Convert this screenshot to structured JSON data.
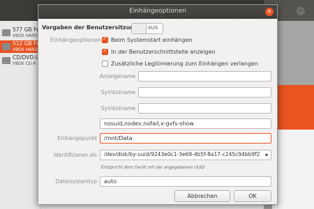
{
  "background": {
    "drives": [
      {
        "line1": "577 GB Fe",
        "line2": "VBOX HARD",
        "selected": false
      },
      {
        "line1": "512 GB Fe",
        "line2": "VBOX HARD",
        "selected": true
      },
      {
        "line1": "CD/DVD-L",
        "line2": "VBOX CD-R",
        "selected": false
      }
    ]
  },
  "dialog": {
    "title": "Einhängeoptionen",
    "user_defaults_label": "Vorgaben der Benutzersitzung",
    "user_defaults_toggle": "AUS",
    "mount_options_label": "Einhängeoptionen",
    "checkboxes": [
      {
        "label": "Beim Systemstart einhängen",
        "checked": true
      },
      {
        "label": "In der Benutzerschnittstelle anzeigen",
        "checked": true
      },
      {
        "label": "Zusätzliche Legitimierung zum Einhängen verlangen",
        "checked": false
      }
    ],
    "display_name_placeholder": "Anzeigename",
    "icon_name_placeholder": "Symbolname",
    "symbolic_icon_name_placeholder": "Symbolname",
    "options_value": "nosuid,nodev,nofail,x-gvfs-show",
    "mount_point_label": "Einhängepunkt",
    "mount_point_value": "/mnt/Data",
    "identify_as_label": "Identifizieren als",
    "identify_as_value": "/dev/disk/by-uuid/9243e0c1-3e69-4b5f-8a17-c245c94bb9f2",
    "identify_hint": "Entspricht dem Gerät mit der angegebenen UUID",
    "fs_type_label": "Dateisystemtyp",
    "fs_type_value": "auto",
    "cancel_label": "Abbrechen",
    "ok_label": "OK"
  },
  "colors": {
    "accent": "#e95420",
    "titlebar": "#3c3b37"
  }
}
